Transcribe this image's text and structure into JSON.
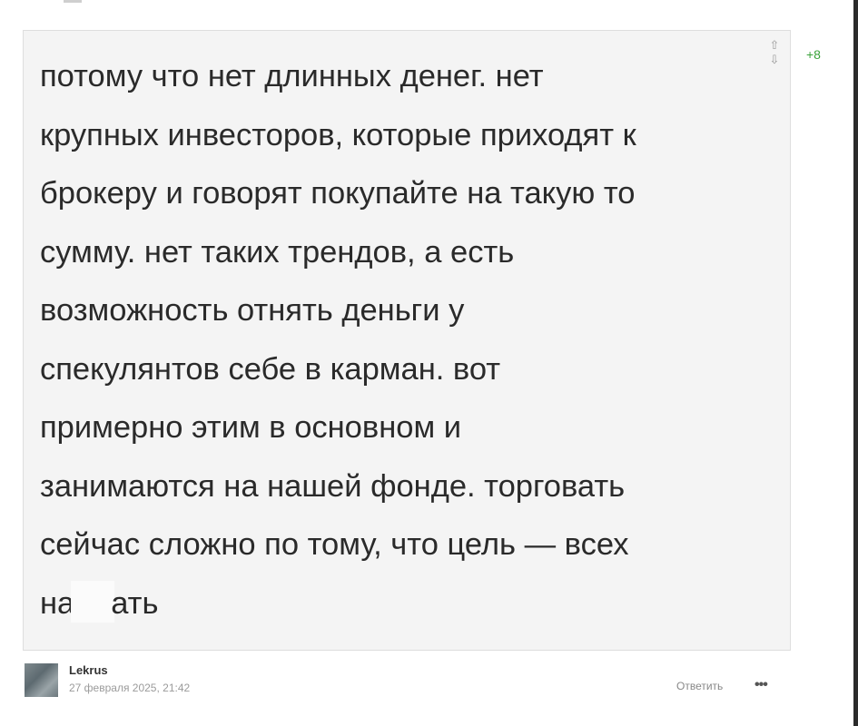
{
  "comment": {
    "text_before_censor": "потому что нет длинных денег. нет\nкрупных инвесторов, которые приходят к\nброкеру и говорят покупайте на такую то\nсумму. нет таких трендов, а есть\nвозможность отнять деньги у\nспекулянтов себе в карман. вот\nпримерно этим в основном и\nзанимаются на нашей фонде. торговать\nсейчас сложно по тому, что цель — всех\nна",
    "text_after_censor": "ать",
    "score": "+8",
    "upvote_icon": "⇧",
    "downvote_icon": "⇩"
  },
  "footer": {
    "author": "Lekrus",
    "date": "27 февраля 2025, 21:42",
    "reply_label": "Ответить",
    "more_label": "•••"
  },
  "colors": {
    "score": "#3aa33a",
    "box_background": "#f4f4f4",
    "text": "#2a2a2a"
  }
}
